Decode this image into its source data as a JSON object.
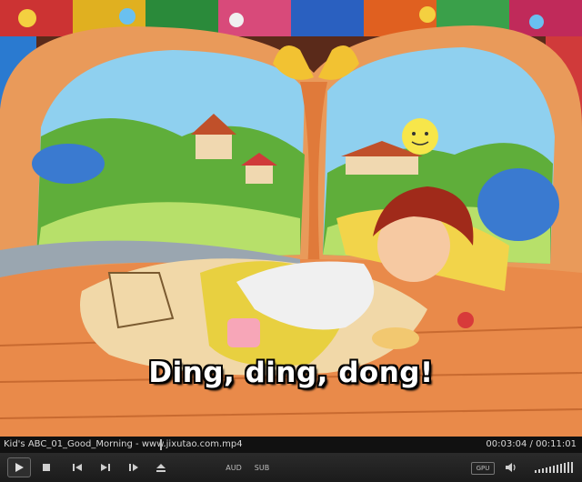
{
  "video": {
    "subtitle": "Ding, ding, dong!"
  },
  "info_bar": {
    "filename": "Kid's ABC_01_Good_Morning - www.jixutao.com.mp4",
    "time_current": "00:03:04",
    "time_separator": "/",
    "time_total": "00:11:01"
  },
  "controls": {
    "aud_label": "AUD",
    "sub_label": "SUB",
    "gpu_label": "GPU",
    "icons": [
      "play-icon",
      "stop-icon",
      "previous-icon",
      "next-icon",
      "frame-step-icon",
      "eject-icon",
      "speaker-icon",
      "volume-level-icon"
    ]
  },
  "colors": {
    "bar_bg": "#111111",
    "control_bg": "#222222",
    "text": "#d8d8d8"
  }
}
